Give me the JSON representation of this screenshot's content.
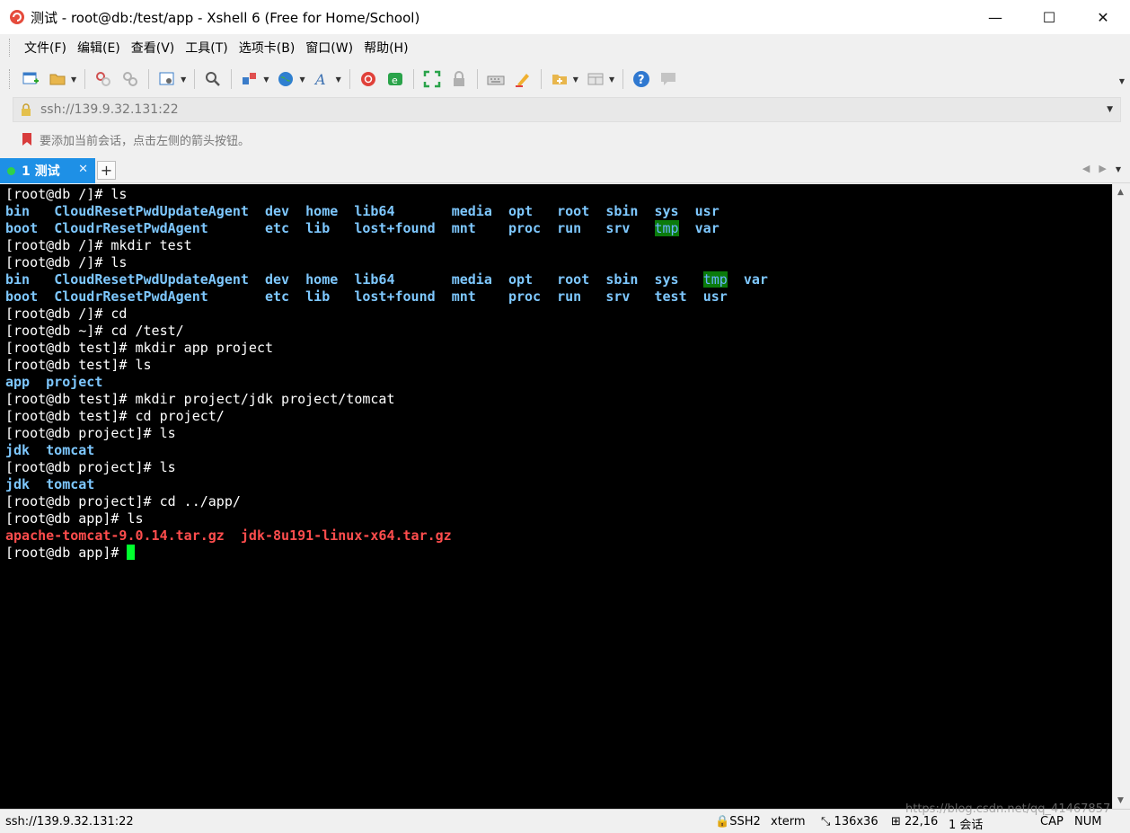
{
  "window": {
    "title": "测试 - root@db:/test/app - Xshell 6 (Free for Home/School)",
    "controls": {
      "minimize": "—",
      "maximize": "☐",
      "close": "✕"
    }
  },
  "menu": {
    "items": [
      "文件(F)",
      "编辑(E)",
      "查看(V)",
      "工具(T)",
      "选项卡(B)",
      "窗口(W)",
      "帮助(H)"
    ]
  },
  "toolbar": {
    "icons": [
      "new-session-icon",
      "open-folder-icon",
      "reconnect-icon",
      "disconnect-icon",
      "properties-icon",
      "find-icon",
      "transfer-icon",
      "globe-icon",
      "font-icon",
      "xshell-icon",
      "xftp-icon",
      "fullscreen-icon",
      "lock-icon",
      "keyboard-icon",
      "highlight-icon",
      "new-tab-group-icon",
      "layout-icon",
      "help-icon",
      "chat-icon"
    ]
  },
  "address": {
    "value": "ssh://139.9.32.131:22"
  },
  "hint": {
    "text": "要添加当前会话，点击左侧的箭头按钮。"
  },
  "tabs": [
    {
      "label": "1 测试",
      "close": "✕",
      "active": true
    }
  ],
  "tab_add_label": "+",
  "terminal": {
    "lines": [
      [
        {
          "t": "[root@db /]# ls"
        }
      ],
      [
        {
          "t": "bin   ",
          "c": "dir"
        },
        {
          "t": "CloudResetPwdUpdateAgent",
          "c": "dir"
        },
        {
          "t": "  "
        },
        {
          "t": "dev",
          "c": "dir"
        },
        {
          "t": "  "
        },
        {
          "t": "home",
          "c": "dir"
        },
        {
          "t": "  "
        },
        {
          "t": "lib64",
          "c": "dir"
        },
        {
          "t": "       "
        },
        {
          "t": "media",
          "c": "dir"
        },
        {
          "t": "  "
        },
        {
          "t": "opt",
          "c": "dir"
        },
        {
          "t": "   "
        },
        {
          "t": "root",
          "c": "dir"
        },
        {
          "t": "  "
        },
        {
          "t": "sbin",
          "c": "dir"
        },
        {
          "t": "  "
        },
        {
          "t": "sys",
          "c": "dir"
        },
        {
          "t": "  "
        },
        {
          "t": "usr",
          "c": "dir"
        }
      ],
      [
        {
          "t": "boot  ",
          "c": "dir"
        },
        {
          "t": "CloudrResetPwdAgent",
          "c": "dir"
        },
        {
          "t": "       "
        },
        {
          "t": "etc",
          "c": "dir"
        },
        {
          "t": "  "
        },
        {
          "t": "lib",
          "c": "dir"
        },
        {
          "t": "   "
        },
        {
          "t": "lost+found",
          "c": "dir"
        },
        {
          "t": "  "
        },
        {
          "t": "mnt",
          "c": "dir"
        },
        {
          "t": "    "
        },
        {
          "t": "proc",
          "c": "dir"
        },
        {
          "t": "  "
        },
        {
          "t": "run",
          "c": "dir"
        },
        {
          "t": "   "
        },
        {
          "t": "srv",
          "c": "dir"
        },
        {
          "t": "   "
        },
        {
          "t": "tmp",
          "c": "tmp"
        },
        {
          "t": "  "
        },
        {
          "t": "var",
          "c": "dir"
        }
      ],
      [
        {
          "t": "[root@db /]# mkdir test"
        }
      ],
      [
        {
          "t": "[root@db /]# ls"
        }
      ],
      [
        {
          "t": "bin   ",
          "c": "dir"
        },
        {
          "t": "CloudResetPwdUpdateAgent",
          "c": "dir"
        },
        {
          "t": "  "
        },
        {
          "t": "dev",
          "c": "dir"
        },
        {
          "t": "  "
        },
        {
          "t": "home",
          "c": "dir"
        },
        {
          "t": "  "
        },
        {
          "t": "lib64",
          "c": "dir"
        },
        {
          "t": "       "
        },
        {
          "t": "media",
          "c": "dir"
        },
        {
          "t": "  "
        },
        {
          "t": "opt",
          "c": "dir"
        },
        {
          "t": "   "
        },
        {
          "t": "root",
          "c": "dir"
        },
        {
          "t": "  "
        },
        {
          "t": "sbin",
          "c": "dir"
        },
        {
          "t": "  "
        },
        {
          "t": "sys",
          "c": "dir"
        },
        {
          "t": "   "
        },
        {
          "t": "tmp",
          "c": "tmp"
        },
        {
          "t": "  "
        },
        {
          "t": "var",
          "c": "dir"
        }
      ],
      [
        {
          "t": "boot  ",
          "c": "dir"
        },
        {
          "t": "CloudrResetPwdAgent",
          "c": "dir"
        },
        {
          "t": "       "
        },
        {
          "t": "etc",
          "c": "dir"
        },
        {
          "t": "  "
        },
        {
          "t": "lib",
          "c": "dir"
        },
        {
          "t": "   "
        },
        {
          "t": "lost+found",
          "c": "dir"
        },
        {
          "t": "  "
        },
        {
          "t": "mnt",
          "c": "dir"
        },
        {
          "t": "    "
        },
        {
          "t": "proc",
          "c": "dir"
        },
        {
          "t": "  "
        },
        {
          "t": "run",
          "c": "dir"
        },
        {
          "t": "   "
        },
        {
          "t": "srv",
          "c": "dir"
        },
        {
          "t": "   "
        },
        {
          "t": "test",
          "c": "dir"
        },
        {
          "t": "  "
        },
        {
          "t": "usr",
          "c": "dir"
        }
      ],
      [
        {
          "t": "[root@db /]# cd"
        }
      ],
      [
        {
          "t": "[root@db ~]# cd /test/"
        }
      ],
      [
        {
          "t": "[root@db test]# mkdir app project"
        }
      ],
      [
        {
          "t": "[root@db test]# ls"
        }
      ],
      [
        {
          "t": "app",
          "c": "dir"
        },
        {
          "t": "  "
        },
        {
          "t": "project",
          "c": "dir"
        }
      ],
      [
        {
          "t": "[root@db test]# mkdir project/jdk project/tomcat"
        }
      ],
      [
        {
          "t": "[root@db test]# cd project/"
        }
      ],
      [
        {
          "t": "[root@db project]# ls"
        }
      ],
      [
        {
          "t": "jdk",
          "c": "dir"
        },
        {
          "t": "  "
        },
        {
          "t": "tomcat",
          "c": "dir"
        }
      ],
      [
        {
          "t": "[root@db project]# ls"
        }
      ],
      [
        {
          "t": "jdk",
          "c": "dir"
        },
        {
          "t": "  "
        },
        {
          "t": "tomcat",
          "c": "dir"
        }
      ],
      [
        {
          "t": "[root@db project]# cd ../app/"
        }
      ],
      [
        {
          "t": "[root@db app]# ls"
        }
      ],
      [
        {
          "t": "apache-tomcat-9.0.14.tar.gz",
          "c": "arch"
        },
        {
          "t": "  "
        },
        {
          "t": "jdk-8u191-linux-x64.tar.gz",
          "c": "arch"
        }
      ],
      [
        {
          "t": "[root@db app]# "
        },
        {
          "cursor": true
        }
      ]
    ]
  },
  "status": {
    "address": "ssh://139.9.32.131:22",
    "protocol": "SSH2",
    "terminal_type": "xterm",
    "size": "136x36",
    "cursor_pos": "22,16",
    "sessions": "1 会话",
    "caps": "CAP",
    "num": "NUM",
    "watermark": "https://blog.csdn.net/qq_41467857"
  },
  "colors": {
    "tab_active": "#1e90e6",
    "terminal_bg": "#000000",
    "dir": "#7ec8ff",
    "archive": "#ff4d4d",
    "cursor": "#00ff2e",
    "tmp_bg": "#0b7a0b"
  }
}
